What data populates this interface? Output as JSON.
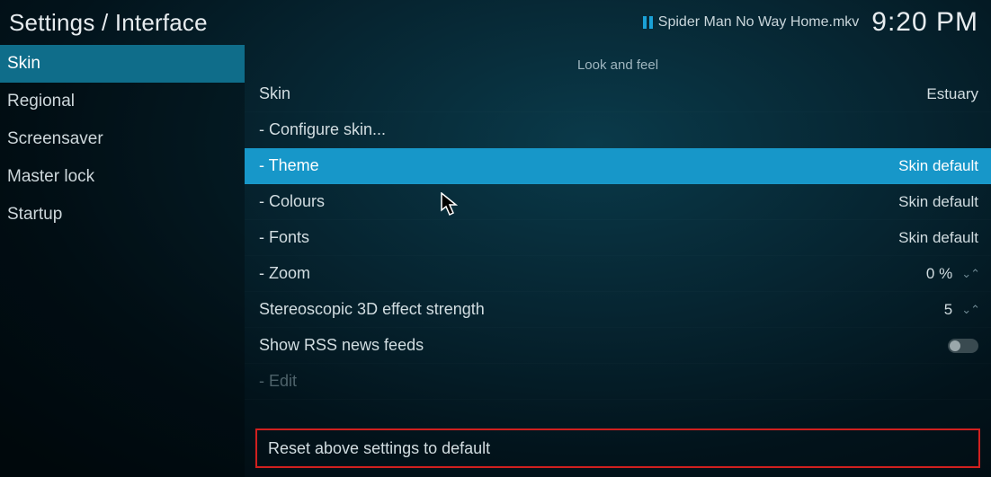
{
  "breadcrumb": "Settings / Interface",
  "now_playing": {
    "title": "Spider Man No Way Home.mkv"
  },
  "clock": "9:20 PM",
  "sidebar": {
    "items": [
      {
        "label": "Skin",
        "active": true
      },
      {
        "label": "Regional",
        "active": false
      },
      {
        "label": "Screensaver",
        "active": false
      },
      {
        "label": "Master lock",
        "active": false
      },
      {
        "label": "Startup",
        "active": false
      }
    ]
  },
  "section_title": "Look and feel",
  "rows": [
    {
      "label": "Skin",
      "value": "Estuary",
      "kind": "text"
    },
    {
      "label": "- Configure skin...",
      "value": "",
      "kind": "action"
    },
    {
      "label": "- Theme",
      "value": "Skin default",
      "kind": "text",
      "selected": true
    },
    {
      "label": "- Colours",
      "value": "Skin default",
      "kind": "text"
    },
    {
      "label": "- Fonts",
      "value": "Skin default",
      "kind": "text"
    },
    {
      "label": "- Zoom",
      "value": "0 %",
      "kind": "spinner"
    },
    {
      "label": "Stereoscopic 3D effect strength",
      "value": "5",
      "kind": "spinner"
    },
    {
      "label": "Show RSS news feeds",
      "value": "",
      "kind": "toggle",
      "toggle_on": false
    },
    {
      "label": "- Edit",
      "value": "",
      "kind": "action",
      "disabled": true
    }
  ],
  "reset_label": "Reset above settings to default"
}
